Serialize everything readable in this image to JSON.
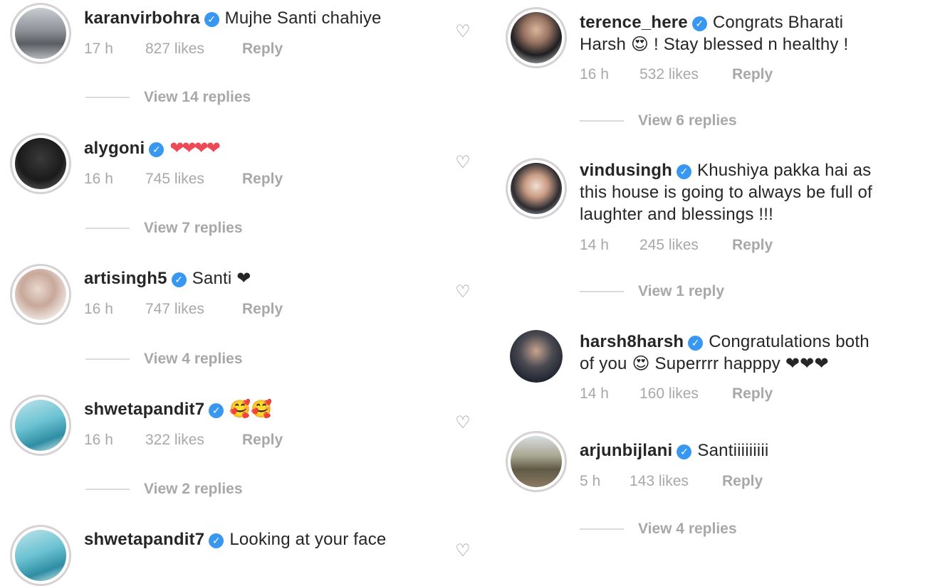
{
  "left_column": [
    {
      "username": "karanvirbohra",
      "verified": true,
      "text": "Mujhe Santi chahiye",
      "time": "17 h",
      "likes": "827 likes",
      "reply": "Reply",
      "view_replies": "View 14 replies"
    },
    {
      "username": "alygoni",
      "verified": true,
      "text": "❤❤❤❤",
      "time": "16 h",
      "likes": "745 likes",
      "reply": "Reply",
      "view_replies": "View 7 replies"
    },
    {
      "username": "artisingh5",
      "verified": true,
      "text": "Santi ❤",
      "time": "16 h",
      "likes": "747 likes",
      "reply": "Reply",
      "view_replies": "View 4 replies"
    },
    {
      "username": "shwetapandit7",
      "verified": true,
      "text": "🥰🥰",
      "time": "16 h",
      "likes": "322 likes",
      "reply": "Reply",
      "view_replies": "View 2 replies"
    },
    {
      "username": "shwetapandit7",
      "verified": true,
      "text": "Looking at your face"
    }
  ],
  "right_column": [
    {
      "username": "terence_here",
      "verified": true,
      "text": "Congrats Bharati",
      "text2": "Harsh 😍 ! Stay blessed n healthy !",
      "time": "16 h",
      "likes": "532 likes",
      "reply": "Reply",
      "view_replies": "View 6 replies"
    },
    {
      "username": "vindusingh",
      "verified": true,
      "text": "Khushiya pakka hai as",
      "text2": "this house is going to always be full of",
      "text3": "laughter and blessings !!!",
      "time": "14 h",
      "likes": "245 likes",
      "reply": "Reply",
      "view_replies": "View 1 reply"
    },
    {
      "username": "harsh8harsh",
      "verified": true,
      "text": "Congratulations both",
      "text2": "of you 😍 Superrrr happpy ❤❤❤",
      "time": "14 h",
      "likes": "160 likes",
      "reply": "Reply"
    },
    {
      "username": "arjunbijlani",
      "verified": true,
      "text": "Santiiiiiiiii",
      "time": "5 h",
      "likes": "143 likes",
      "reply": "Reply",
      "view_replies": "View 4 replies"
    }
  ],
  "icons": {
    "verified": "verified-badge-icon",
    "like": "heart-outline-icon"
  },
  "colors": {
    "verified": "#3897f0",
    "meta": "#a8a8a8",
    "heart": "#ed4956",
    "avatar_ring": "#d6d1d4"
  }
}
